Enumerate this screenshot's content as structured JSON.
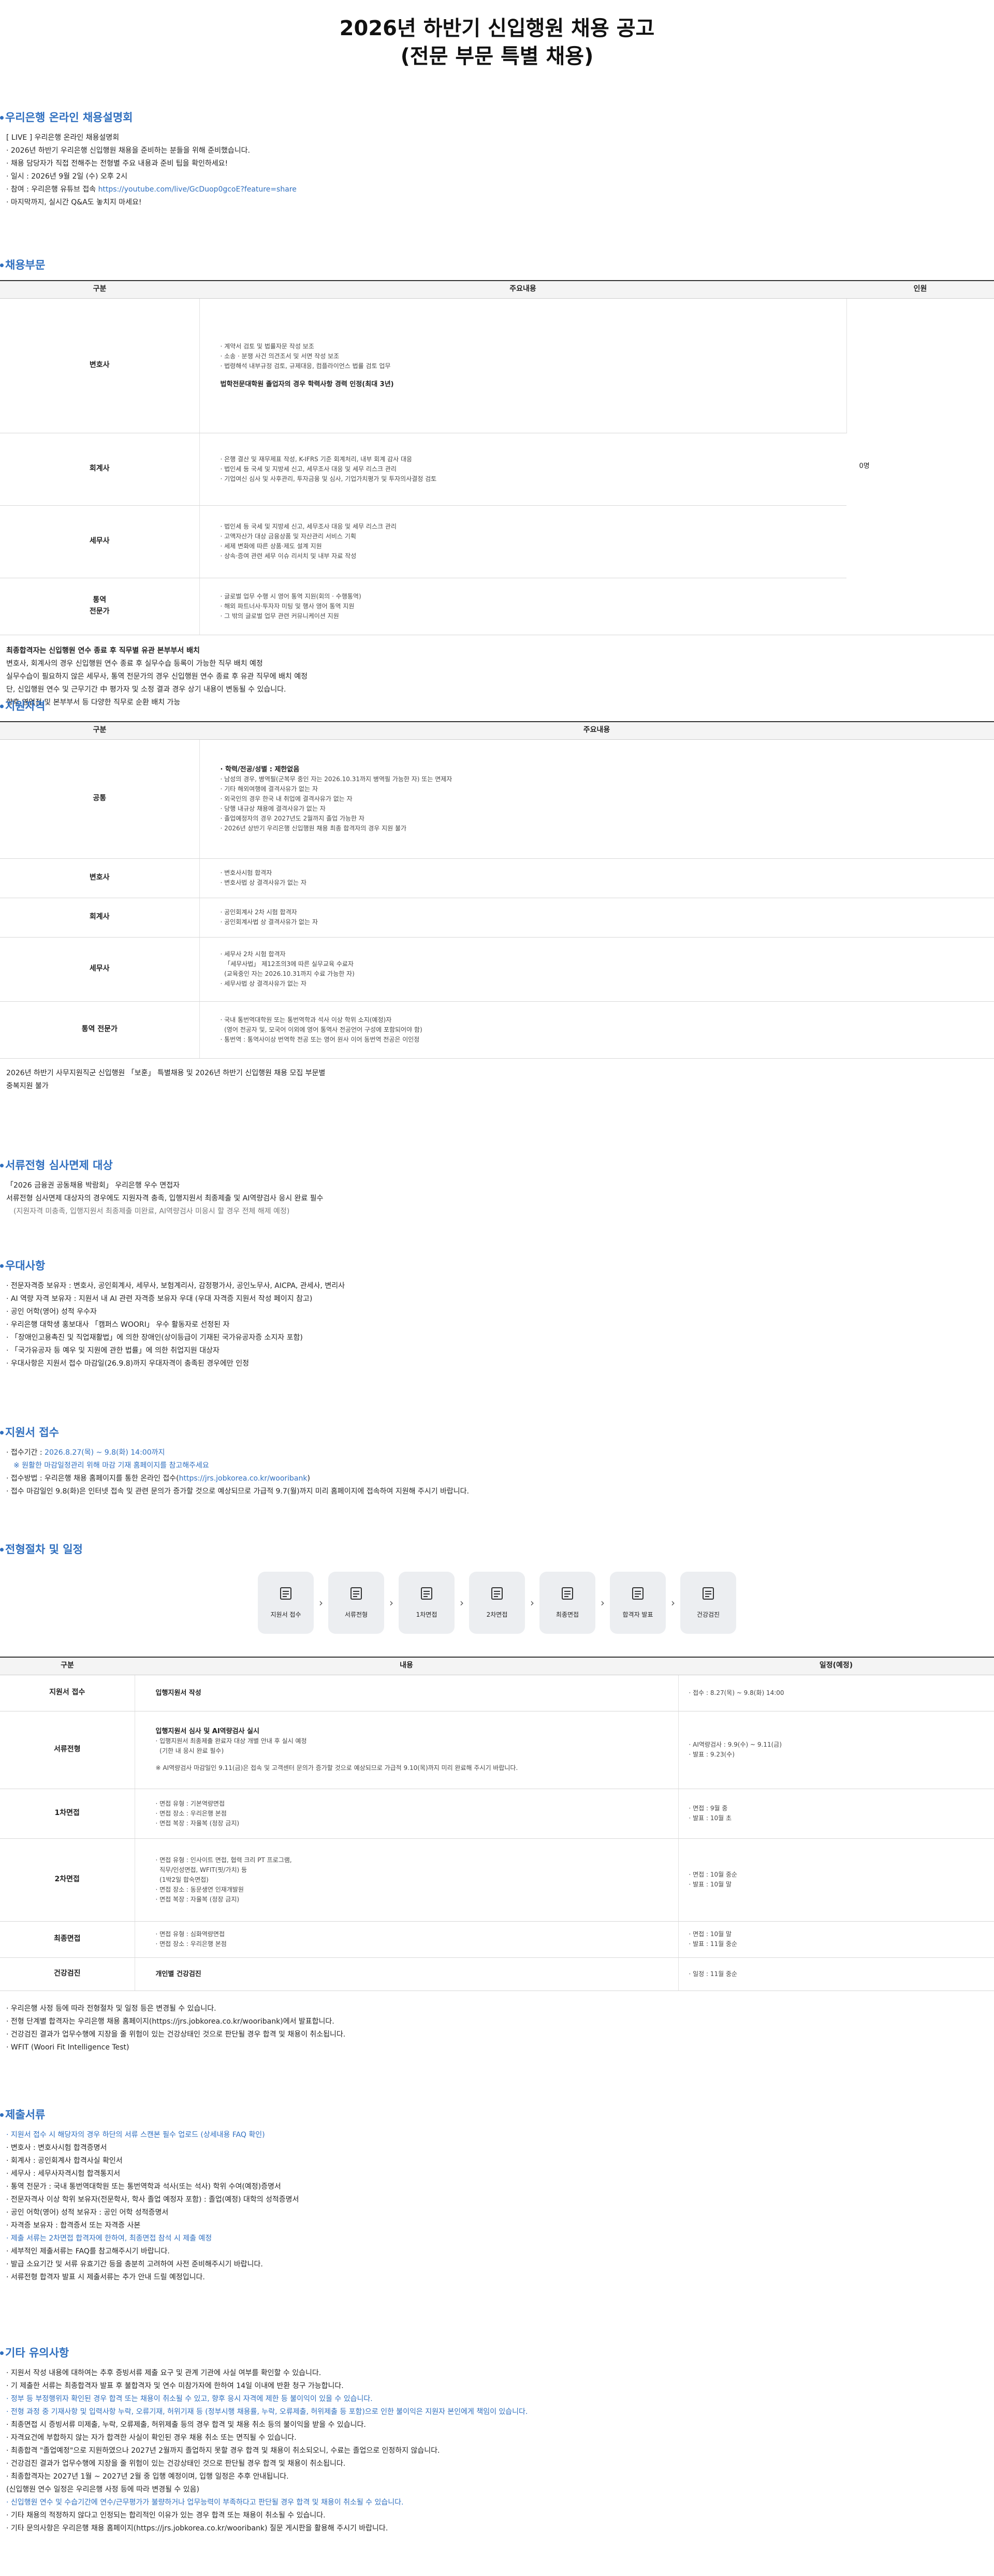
{
  "page": {
    "title1": "2026년 하반기 신입행원 채용 공고",
    "title2": "(전문 부문 특별 채용)"
  },
  "briefing": {
    "heading": "우리은행 온라인 채용설명회",
    "items": [
      "[ LIVE ] 우리은행 온라인 채용설명회",
      "· 2026년 하반기 우리은행 신입행원 채용을 준비하는 분들을 위해 준비했습니다.",
      "· 채용 담당자가 직접 전해주는 전형별 주요 내용과 준비 팁을 확인하세요!",
      "· 일시 : 2026년 9월 2일 (수) 오후 2시",
      "· 마지막까지, 실시간 Q&A도 놓치지 마세요!"
    ],
    "link_prefix": "· 참여 : 우리은행 유튜브 접속 ",
    "link": "https://youtube.com/live/GcDuop0gcoE?feature=share"
  },
  "positions": {
    "heading": "채용부문",
    "cols": [
      "구분",
      "주요내용",
      "인원"
    ],
    "count": "0명",
    "rows": [
      {
        "name": "변호사",
        "lines": [
          "· 계약서 검토 및 법률자문 작성 보조",
          "· 소송 · 분쟁 사건 의견조서 및 서면 작성 보조",
          "· 법령해석 내부규정 검토, 규제대응, 컴플라이언스 법률 검토 업무"
        ],
        "extra": "법학전문대학원 졸업자의 경우 학력사항 경력 인정(최대 3년)"
      },
      {
        "name": "회계사",
        "lines": [
          "· 은행 결산 및 재무제표 작성, K-IFRS 기준 회계처리, 내부 회계 감사 대응",
          "· 법인세 등 국세 및 지방세 신고, 세무조사 대응 및 세무 리스크 관리",
          "· 기업여신 심사 및 사후관리, 투자금융 및 심사, 기업가치평가 및 투자의사결정 검토"
        ]
      },
      {
        "name": "세무사",
        "lines": [
          "· 법인세 등 국세 및 지방세 신고, 세무조사 대응 및 세무 리스크 관리",
          "· 고액자산가 대상 금융상품 및 자산관리 서비스 기획",
          "· 세제 변화에 따른 상품·제도 설계 지원",
          "· 상속·증여 관련 세무 이슈 리서치 및 내부 자료 작성"
        ]
      },
      {
        "name": "통역\n전문가",
        "lines": [
          "· 글로벌 업무 수행 시 영어 통역 지원(회의 · 수행통역)",
          "· 해외 파트너사·투자자 미팅 및 행사 영어 통역 지원",
          "· 그 밖의 글로벌 업무 관련 커뮤니케이션 지원"
        ]
      }
    ],
    "notes": [
      "최종합격자는 신입행원 연수 종료 후 직무별 유관 본부부서 배치",
      "변호사, 회계사의 경우 신입행원 연수 종료 후 실무수습 등록이 가능한 직무 배치 예정",
      "실무수습이 필요하지 않은 세무사, 통역 전문가의 경우 신입행원 연수 종료 후 유관 직무에 배치 예정",
      "단, 신입행원 연수 및 근무기간 中 평가자 및 소정 결과 경우 상기 내용이 변동될 수 있습니다.",
      "향후 영업점 및 본부부서 등 다양한 직무로 순환 배치 가능"
    ]
  },
  "qualify": {
    "heading": "지원자격",
    "cols": [
      "구분",
      "주요내용"
    ],
    "rows": [
      {
        "name": "공통",
        "lines": [
          "· 학력/전공/성별 : 제한없음",
          "· 남성의 경우, 병역필(군복무 중인 자는 2026.10.31까지 병역필 가능한 자) 또는 면제자",
          "· 기타 해외여행에 결격사유가 없는 자",
          "· 외국인의 경우 한국 내 취업에 결격사유가 없는 자",
          "· 당행 내규상 채용에 결격사유가 없는 자",
          "· 졸업예정자의 경우 2027년도 2월까지 졸업 가능한 자",
          "· 2026년 상반기 우리은행 신입행원 채용 최종 합격자의 경우 지원 불가"
        ],
        "firstbold": true
      },
      {
        "name": "변호사",
        "lines": [
          "· 변호사시험 합격자",
          "· 변호사법 상 결격사유가 없는 자"
        ]
      },
      {
        "name": "회계사",
        "lines": [
          "· 공인회계사 2차 시험 합격자",
          "· 공인회계사법 상 결격사유가 없는 자"
        ]
      },
      {
        "name": "세무사",
        "lines": [
          "· 세무사 2차 시험 합격자",
          "  「세무사법」 제12조의3에 따른 실무교육 수료자",
          "  (교육중인 자는 2026.10.31까지 수료 가능한 자)",
          "· 세무사법 상 결격사유가 없는 자"
        ]
      },
      {
        "name": "통역 전문가",
        "lines": [
          "· 국내 통번역대학원 또는 통번역학과 석사 이상 학위 소지(예정)자",
          "  (영어 전공자 및, 모국어 이외에 영어 통역사 전공언어 구성에 포함되어야 함)",
          "· 통번역 : 통역사이상 번역학 전공 또는 영어 원사 이어 동번역 전공은 이인정"
        ]
      }
    ],
    "notes": [
      "2026년 하반기 사무지원직군 신입행원 「보훈」 특별채용 및 2026년 하반기 신입행원 채용 모집 부문별",
      "중복지원 불가"
    ]
  },
  "exempt": {
    "heading": "서류전형 심사면제 대상",
    "items": [
      "「2026 금융권 공동채용 박람회」 우리은행 우수 면접자",
      "서류전형 심사면제 대상자의 경우에도 지원자격 충족, 입행지원서 최종제출 및 AI역량검사 응시 완료 필수",
      "(지원자격 미충족, 입행지원서 최종제출 미완료, AI역량검사 미응시 할 경우 전체 해제 예정)"
    ]
  },
  "pref": {
    "heading": "우대사항",
    "items": [
      "· 전문자격증 보유자 : 변호사, 공인회계사, 세무사, 보험계리사, 감정평가사, 공인노무사, AICPA, 관세사, 변리사",
      "· AI 역량 자격 보유자 : 지원서 내 AI 관련 자격증 보유자 우대 (우대 자격증 지원서 작성 페이지 참고)",
      "· 공인 어학(영어) 성적 우수자",
      "· 우리은행 대학생 홍보대사 「캠퍼스 WOORI」 우수 활동자로 선정된 자",
      "· 「장애인고용촉진 및 직업재활법」에 의한 장애인(상이등급이 기재된 국가유공자증 소지자 포함)",
      "· 「국가유공자 등 예우 및 지원에 관한 법률」에 의한 취업지원 대상자",
      "· 우대사항은 지원서 접수 마감일(26.9.8)까지 우대자격이 충족된 경우에만 인정"
    ]
  },
  "apply": {
    "heading": "지원서 접수",
    "period_label": "· 접수기간 : ",
    "period": "2026.8.27(목) ~ 9.8(화) 14:00까지",
    "note": "※ 원활한 마감일정관리 위해 마감 기재 홈페이지를 참고해주세요",
    "method_prefix": "· 접수방법 : 우리은행 채용 홈페이지를 통한 온라인 접수(",
    "method_link": "https://jrs.jobkorea.co.kr/wooribank",
    "method_suffix": ")",
    "closing": "· 접수 마감일인 9.8(화)은 인터넷 접속 및 관련 문의가 증가할 것으로 예상되므로 가급적 9.7(월)까지 미리 홈페이지에 접속하여 지원해 주시기 바랍니다."
  },
  "process": {
    "heading": "전형절차 및 일정",
    "steps": [
      "지원서 접수",
      "서류전형",
      "1차면접",
      "2차면접",
      "최종면접",
      "합격자 발표",
      "건강검진"
    ],
    "cols": [
      "구분",
      "내용",
      "일정(예정)"
    ],
    "rows": [
      {
        "name": "지원서 접수",
        "lines": [
          "입행지원서 작성"
        ],
        "bold": [
          0
        ],
        "sched": [
          "· 접수 : 8.27(목) ~ 9.8(화) 14:00"
        ]
      },
      {
        "name": "서류전형",
        "lines": [
          "입행지원서 심사 및 AI역량검사 실시",
          "· 입행지원서 최종제출 완료자 대상 개별 안내 후 실시 예정",
          "  (기한 내 응시 완료 필수)",
          "",
          "※ AI역량검사 마감일인 9.11(금)은 접속 및 고객센터 문의가 증가할 것으로 예상되므로 가급적 9.10(목)까지 미리 완료해 주시기 바랍니다."
        ],
        "bold": [
          0
        ],
        "sched": [
          "· AI역량검사 : 9.9(수) ~ 9.11(금)",
          "· 발표 : 9.23(수)"
        ]
      },
      {
        "name": "1차면접",
        "lines": [
          "· 면접 유형 : 기본역량면접",
          "· 면접 장소 : 우리은행 본점",
          "· 면접 복장 : 자율복 (정장 금지)"
        ],
        "sched": [
          "· 면접 : 9월 중",
          "· 발표 : 10월 초"
        ]
      },
      {
        "name": "2차면접",
        "lines": [
          "· 면접 유형 : 인사이트 면접, 협력 크리 PT 프로그램,",
          "  직무/인성면접, WFIT(핏/가치) 등",
          "  (1박2일 합숙면접)",
          "· 면접 장소 : 동문생연 인재개발원",
          "· 면접 복장 : 자율복 (정장 금지)"
        ],
        "sched": [
          "· 면접 : 10월 중순",
          "· 발표 : 10월 말"
        ]
      },
      {
        "name": "최종면접",
        "lines": [
          "· 면접 유형 : 심화역량면접",
          "· 면접 장소 : 우리은행 본점"
        ],
        "sched": [
          "· 면접 : 10월 말",
          "· 발표 : 11월 중순"
        ]
      },
      {
        "name": "건강검진",
        "lines": [
          "개인별 건강검진"
        ],
        "bold": [
          0
        ],
        "sched": [
          "· 일정 : 11월 중순"
        ]
      }
    ],
    "notes": [
      "· 우리은행 사정 등에 따라 전형절차 및 일정 등은 변경될 수 있습니다.",
      "· 전형 단계별 합격자는 우리은행 채용 홈페이지(https://jrs.jobkorea.co.kr/wooribank)에서 발표합니다.",
      "· 건강검진 결과가 업무수행에 지장을 줄 위험이 있는 건강상태인 것으로 판단될 경우 합격 및 채용이 취소됩니다.",
      "· WFIT (Woori Fit Intelligence Test)"
    ]
  },
  "docs": {
    "heading": "제출서류",
    "items": [
      "· 지원서 접수 시 해당자의 경우 하단의 서류 스캔본 필수 업로드 (상세내용 FAQ 확인)",
      "· 변호사 : 변호사시험 합격증명서",
      "· 회계사 : 공인회계사 합격사실 확인서",
      "· 세무사 : 세무사자격시험 합격통지서",
      "· 통역 전문가 : 국내 통번역대학원 또는 통번역학과 석사(또는 석사) 학위 수여(예정)증명서",
      "· 전문자격사 이상 학위 보유자(전문학사, 학사 졸업 예정자 포함) : 졸업(예정) 대학의 성적증명서",
      "· 공인 어학(영어) 성적 보유자 : 공인 어학 성적증명서",
      "· 자격증 보유자 : 합격증서 또는 자격증 사본",
      "· 제출 서류는 2차면접 합격자에 한하여, 최종면접 참석 시 제출 예정",
      "· 세부적인 제출서류는 FAQ를 참고해주시기 바랍니다.",
      "· 발급 소요기간 및 서류 유효기간 등을 충분히 고려하여 사전 준비해주시기 바랍니다.",
      "· 서류전형 합격자 발표 시 제출서류는 추가 안내 드릴 예정입니다."
    ]
  },
  "caution": {
    "heading": "기타 유의사항",
    "items": [
      "· 지원서 작성 내용에 대하여는 추후 증빙서류 제출 요구 및 관계 기관에 사실 여부를 확인할 수 있습니다.",
      "· 기 제출한 서류는 최종합격자 발표 후 불합격자 및 연수 미참가자에 한하여 14일 이내에 반환 청구 가능합니다.",
      "· 정부 등 부정행위자 확인된 경우 합격 또는 채용이 취소될 수 있고, 향후 응시 자격에 제한 등 불이익이 있을 수 있습니다.",
      "· 전형 과정 중 기재사항 및 입력사항 누락, 오류기재, 허위기재 등 (정부시행 채용률, 누락, 오류제출, 허위제출 등 포함)으로 인한 불이익은 지원자 본인에게 책임이 있습니다.",
      "· 최종면접 시 증빙서류 미제출, 누락, 오류제출, 허위제출 등의 경우 합격 및 채용 취소 등의 불이익을 받을 수 있습니다.",
      "· 자격요건에 부합하지 않는 자가 합격한 사실이 확인된 경우 채용 취소 또는 면직될 수 있습니다.",
      "· 최종합격 \"졸업예정\"으로 지원하였으나 2027년 2월까지 졸업하지 못할 경우 합격 및 채용이 취소되오니, 수료는 졸업으로 인정하지 않습니다.",
      "· 건강검진 결과가 업무수행에 지장을 줄 위험이 있는 건강상태인 것으로 판단될 경우 합격 및 채용이 취소됩니다.",
      "· 최종합격자는 2027년 1월 ~ 2027년 2월 중 입행 예정이며, 입행 일정은 추후 안내됩니다.",
      "  (신입행원 연수 일정은 우리은행 사정 등에 따라 변경될 수 있음)",
      "· 신입행원 연수 및 수습기간에 연수/근무평가가 불량하거나 업무능력이 부족하다고 판단될 경우 합격 및 채용이 취소될 수 있습니다.",
      "· 기타 채용의 적정하지 않다고 인정되는 합리적인 이유가 있는 경우 합격 또는 채용이 취소될 수 있습니다.",
      "· 기타 문의사항은 우리은행 채용 홈페이지(https://jrs.jobkorea.co.kr/wooribank) 질문 게시판을 활용해 주시기 바랍니다."
    ],
    "blue": [
      2,
      3,
      10
    ]
  },
  "colors": {
    "accent": "#2f6fbf",
    "red": "#dd3333"
  }
}
